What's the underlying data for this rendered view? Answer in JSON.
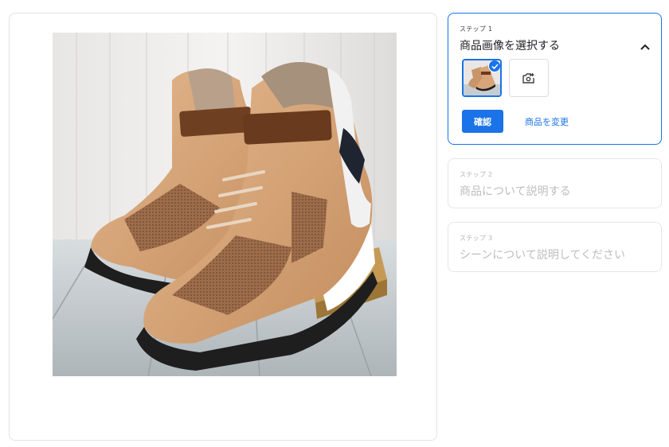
{
  "steps": [
    {
      "number": "ステップ 1",
      "title": "商品画像を選択する",
      "expanded": true
    },
    {
      "number": "ステップ 2",
      "title": "商品について説明する",
      "expanded": false
    },
    {
      "number": "ステップ 3",
      "title": "シーンについて説明してください",
      "expanded": false
    }
  ],
  "step1": {
    "confirm_label": "確認",
    "change_product_label": "商品を変更"
  },
  "colors": {
    "accent": "#1a73e8",
    "disabled_text": "#bdbdbd",
    "border": "#e3e3e3"
  },
  "icons": {
    "collapse": "chevron-up-icon",
    "selected": "check-icon",
    "add_image": "add-photo-icon"
  }
}
